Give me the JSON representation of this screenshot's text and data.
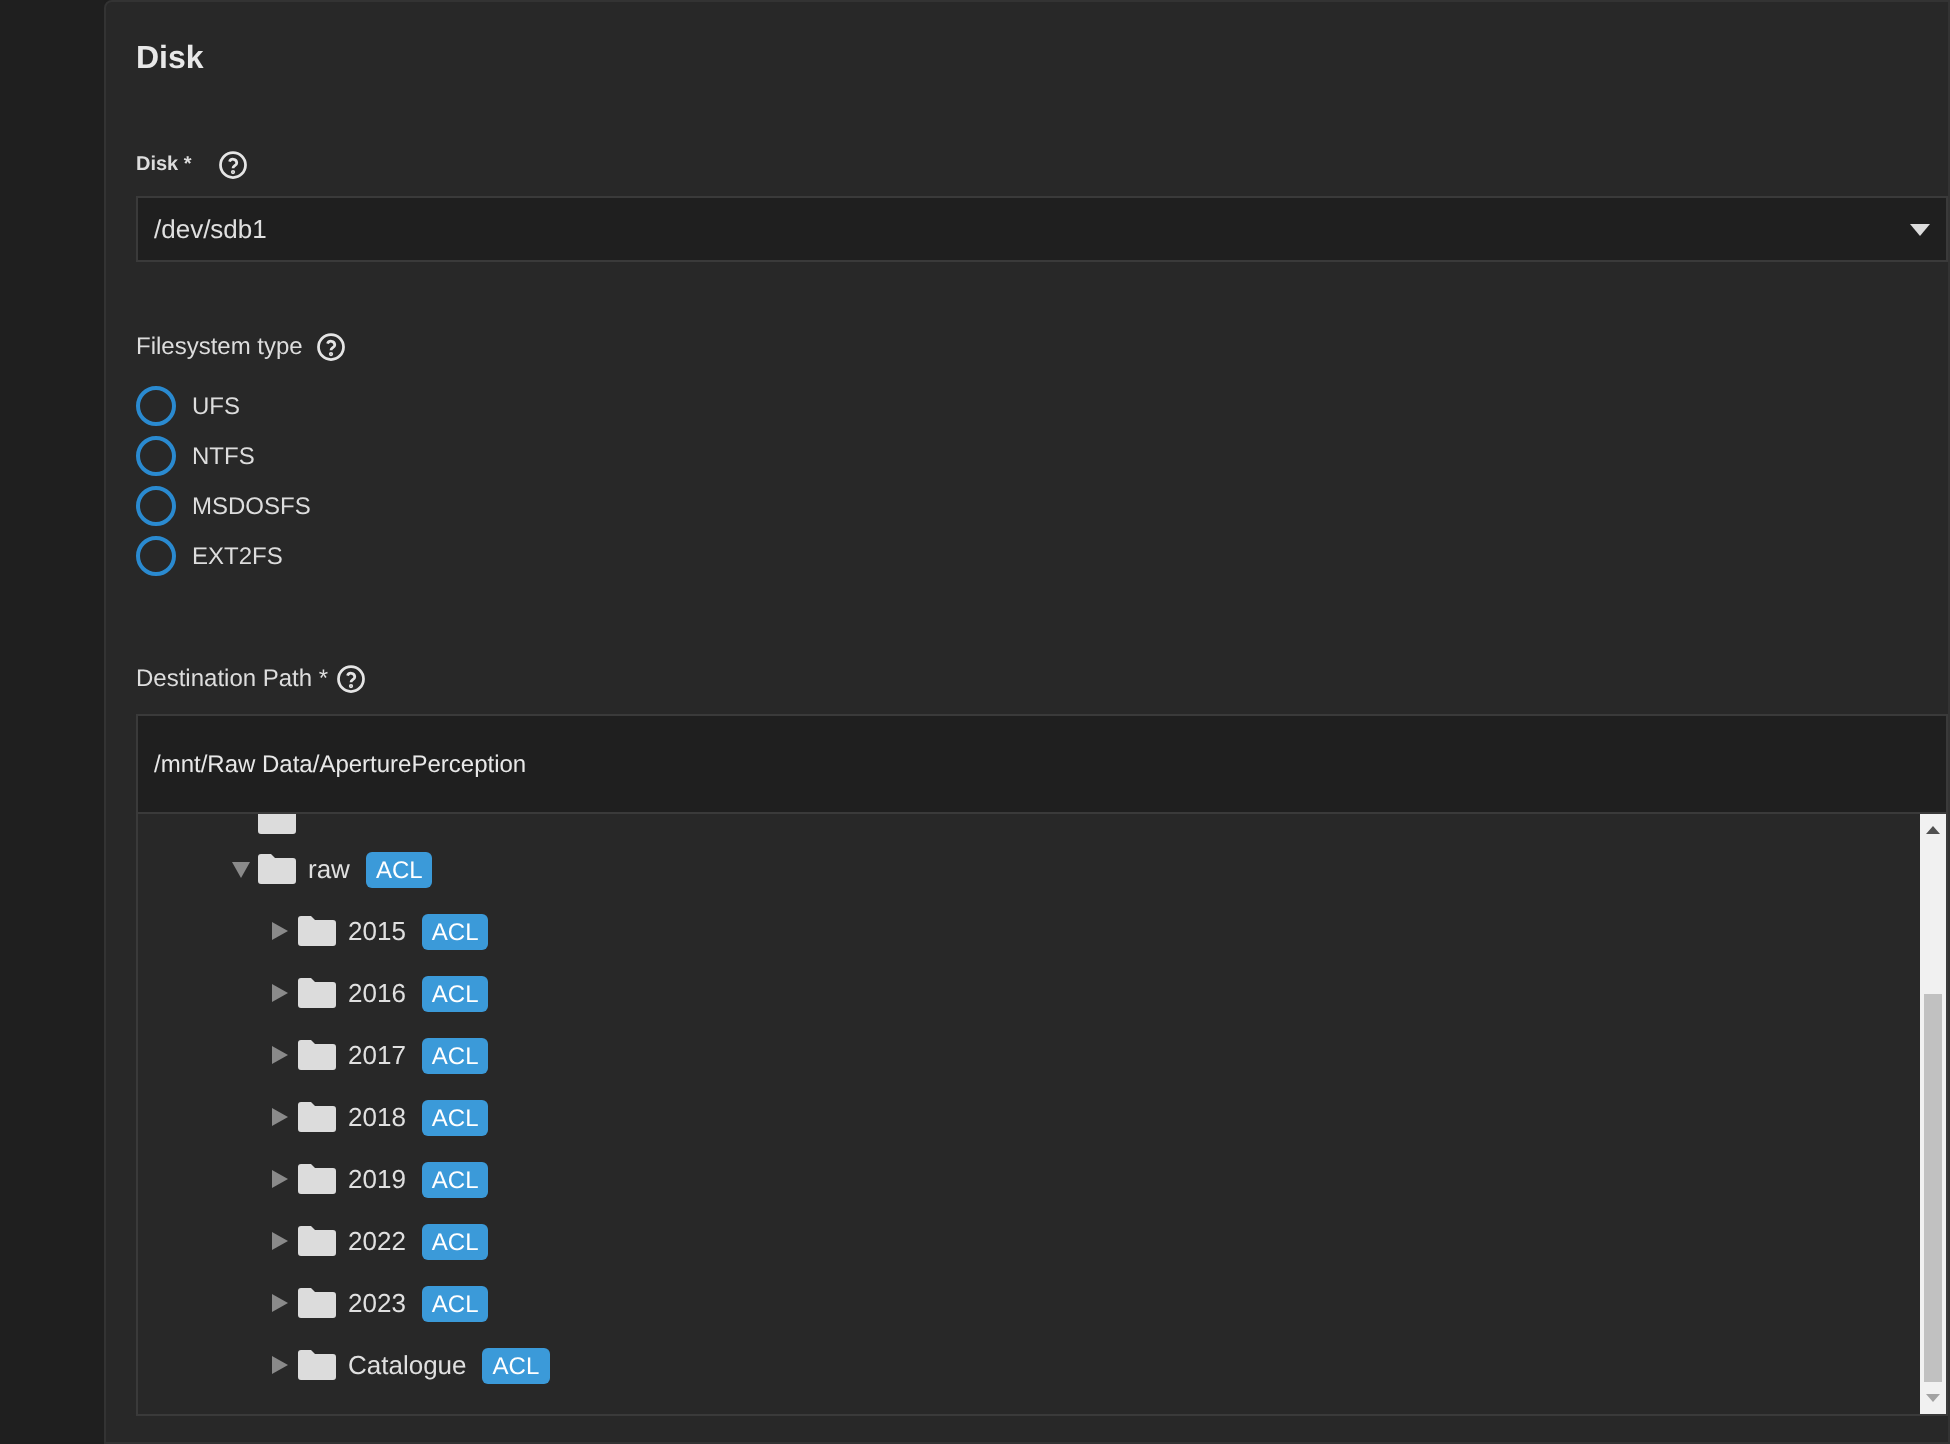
{
  "card": {
    "title": "Disk"
  },
  "disk": {
    "label": "Disk *",
    "value": "/dev/sdb1"
  },
  "filesystem_type": {
    "label": "Filesystem type",
    "options": [
      {
        "label": "UFS",
        "selected": false
      },
      {
        "label": "NTFS",
        "selected": false
      },
      {
        "label": "MSDOSFS",
        "selected": false
      },
      {
        "label": "EXT2FS",
        "selected": false
      }
    ]
  },
  "destination": {
    "label": "Destination Path *",
    "value": "/mnt/Raw Data/AperturePerception",
    "tree": [
      {
        "name": "raw",
        "badge": "ACL",
        "expanded": true,
        "children": [
          {
            "name": "2015",
            "badge": "ACL",
            "expanded": false
          },
          {
            "name": "2016",
            "badge": "ACL",
            "expanded": false
          },
          {
            "name": "2017",
            "badge": "ACL",
            "expanded": false
          },
          {
            "name": "2018",
            "badge": "ACL",
            "expanded": false
          },
          {
            "name": "2019",
            "badge": "ACL",
            "expanded": false
          },
          {
            "name": "2022",
            "badge": "ACL",
            "expanded": false
          },
          {
            "name": "2023",
            "badge": "ACL",
            "expanded": false
          },
          {
            "name": "Catalogue",
            "badge": "ACL",
            "expanded": false
          }
        ]
      }
    ]
  }
}
